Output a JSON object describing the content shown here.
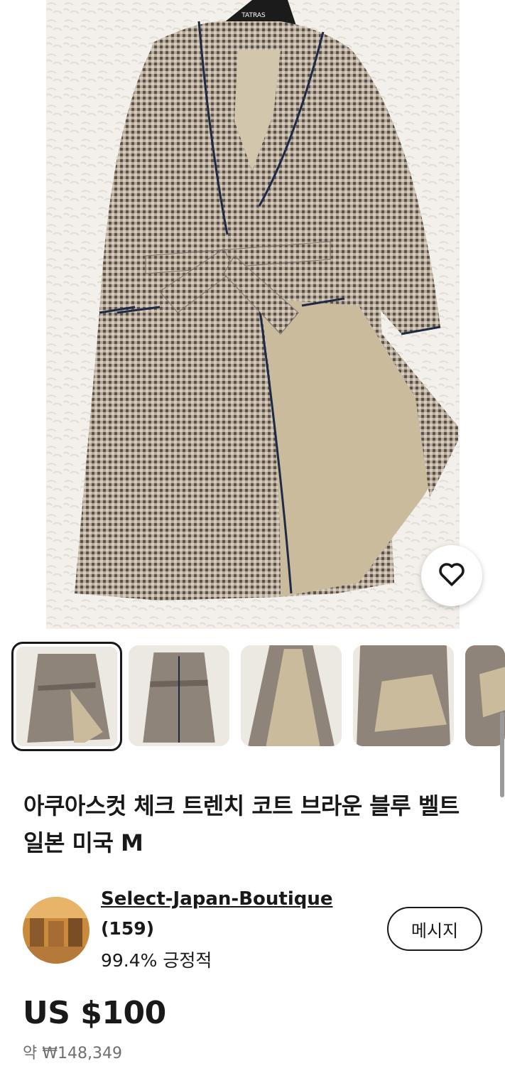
{
  "product": {
    "title": "아쿠아스컷 체크 트렌치 코트 브라운 블루 벨트 일본 미국 M",
    "hanger_brand": "TATRAS",
    "price": "US $100",
    "price_approx": "약 ₩148,349"
  },
  "seller": {
    "name": "Select-Japan-Boutique",
    "feedback_count": "(159)",
    "positive": "99.4% 긍정적",
    "message_label": "메시지"
  },
  "gallery": {
    "thumbnail_count": 5,
    "selected_index": 0
  },
  "icons": {
    "favorite": "heart-outline-icon"
  },
  "colors": {
    "text": "#191919",
    "muted": "#707070",
    "coat_check": "#8a8078",
    "lining": "#c9bb9c",
    "piping": "#1f2a44"
  }
}
